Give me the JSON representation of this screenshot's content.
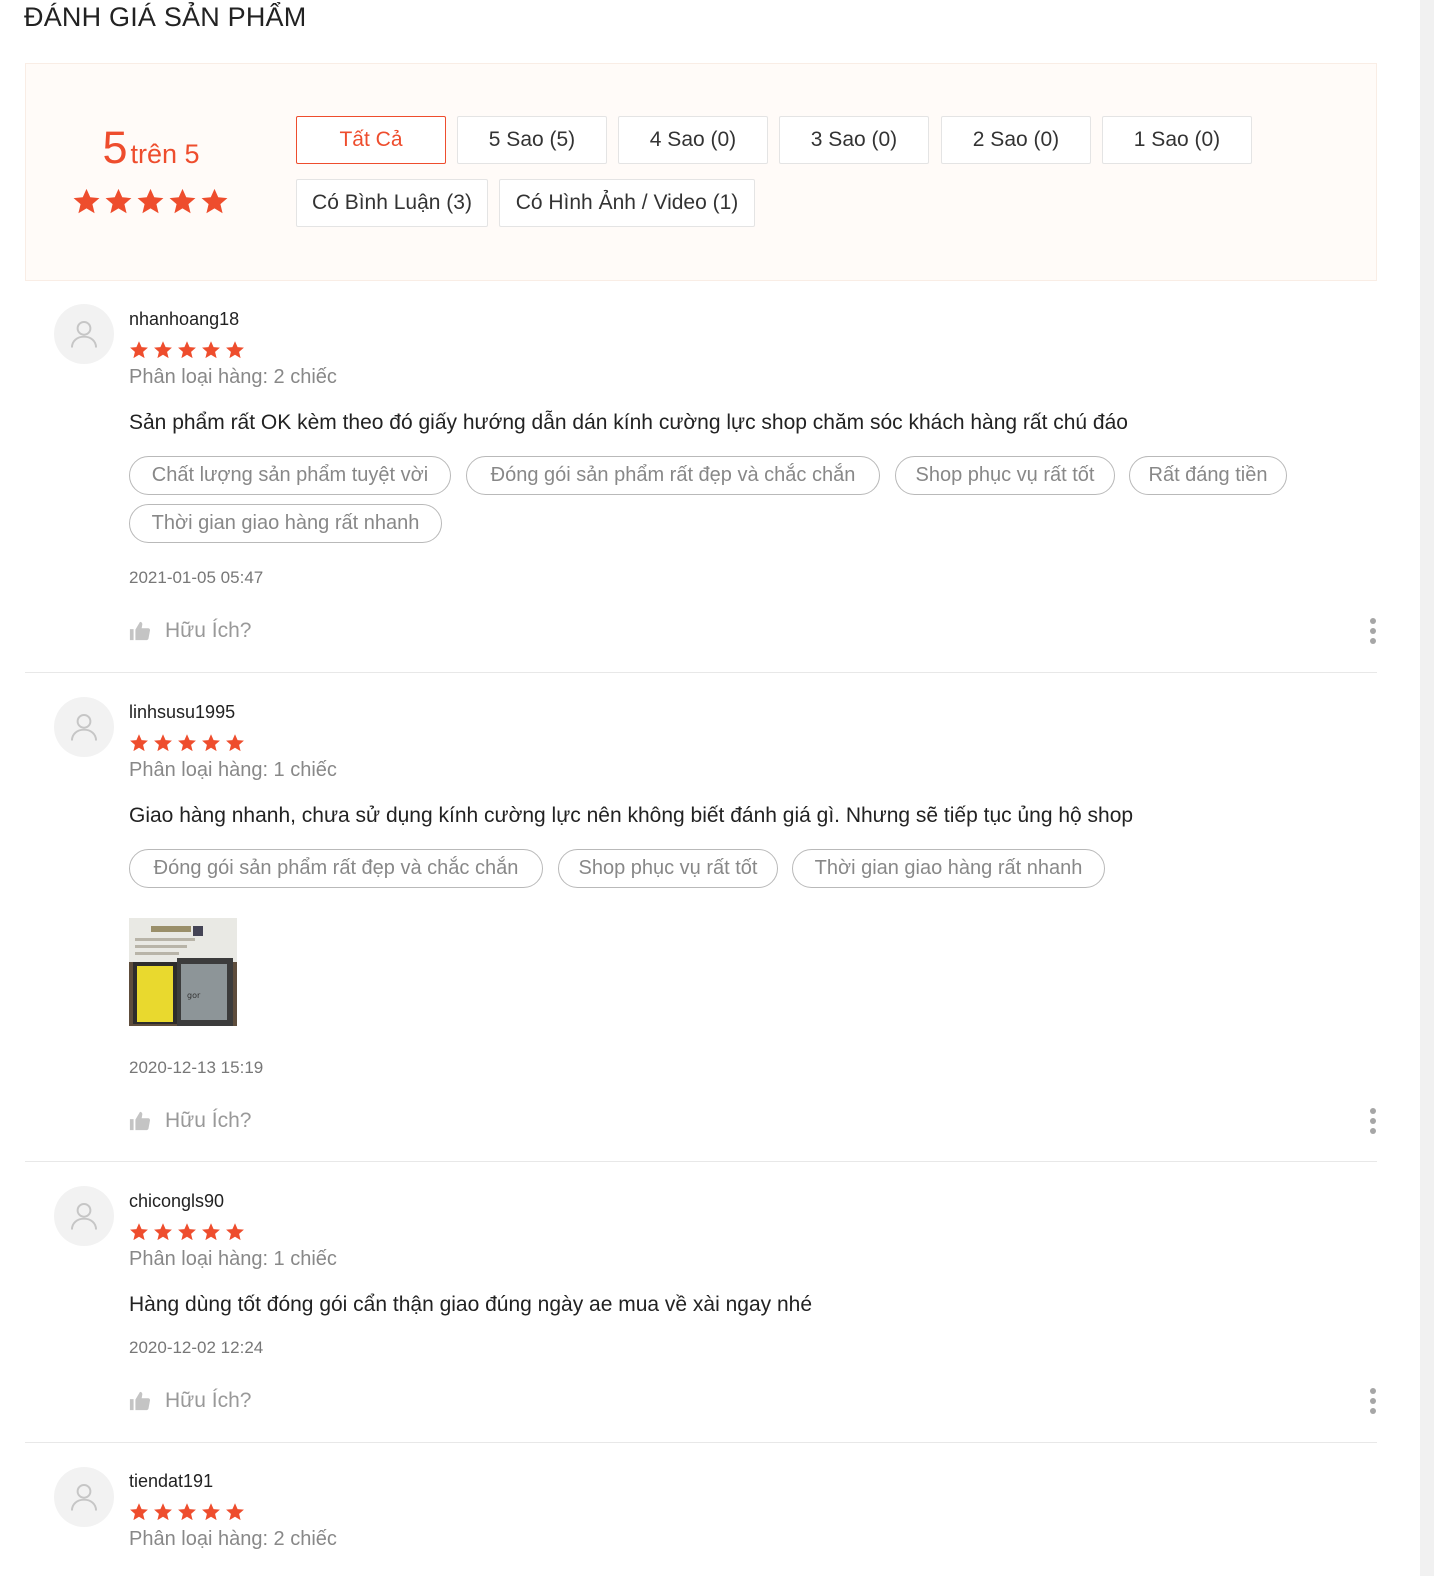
{
  "section_title": "ĐÁNH GIÁ SẢN PHẨM",
  "overview": {
    "score": "5",
    "score_suffix": "trên 5",
    "stars": 5
  },
  "filters": [
    {
      "label": "Tất Cả",
      "active": true
    },
    {
      "label": "5 Sao (5)",
      "active": false
    },
    {
      "label": "4 Sao (0)",
      "active": false
    },
    {
      "label": "3 Sao (0)",
      "active": false
    },
    {
      "label": "2 Sao (0)",
      "active": false
    },
    {
      "label": "1 Sao (0)",
      "active": false
    },
    {
      "label": "Có Bình Luận (3)",
      "active": false
    },
    {
      "label": "Có Hình Ảnh / Video (1)",
      "active": false
    }
  ],
  "colors": {
    "accent": "#ee4d2d",
    "tag_border": "#b9b9b9",
    "muted": "#888888"
  },
  "reviews": [
    {
      "username": "nhanhoang18",
      "rating": 5,
      "variant": "Phân loại hàng: 2 chiếc",
      "comment": "Sản phẩm rất OK kèm theo đó giấy hướng dẫn dán kính cường lực shop chăm sóc khách hàng rất chú đáo",
      "tags": [
        "Chất lượng sản phẩm tuyệt vời",
        "Đóng gói sản phẩm rất đẹp và chắc chắn",
        "Shop phục vụ rất tốt",
        "Rất đáng tiền",
        "Thời gian giao hàng rất nhanh"
      ],
      "time": "2021-01-05 05:47",
      "helpful": "Hữu Ích?"
    },
    {
      "username": "linhsusu1995",
      "rating": 5,
      "variant": "Phân loại hàng: 1 chiếc",
      "comment": "Giao hàng nhanh, chưa sử dụng kính cường lực nên không biết đánh giá gì. Nhưng sẽ tiếp tục ủng hộ shop",
      "tags": [
        "Đóng gói sản phẩm rất đẹp và chắc chắn",
        "Shop phục vụ rất tốt",
        "Thời gian giao hàng rất nhanh"
      ],
      "photo_icon": "product-photo-thumbnail",
      "time": "2020-12-13 15:19",
      "helpful": "Hữu Ích?"
    },
    {
      "username": "chicongls90",
      "rating": 5,
      "variant": "Phân loại hàng: 1 chiếc",
      "comment": "Hàng dùng tốt đóng gói cẩn thận giao đúng ngày ae mua về xài ngay nhé",
      "tags": [],
      "time": "2020-12-02 12:24",
      "helpful": "Hữu Ích?"
    },
    {
      "username": "tiendat191",
      "rating": 5,
      "variant": "Phân loại hàng: 2 chiếc"
    }
  ]
}
